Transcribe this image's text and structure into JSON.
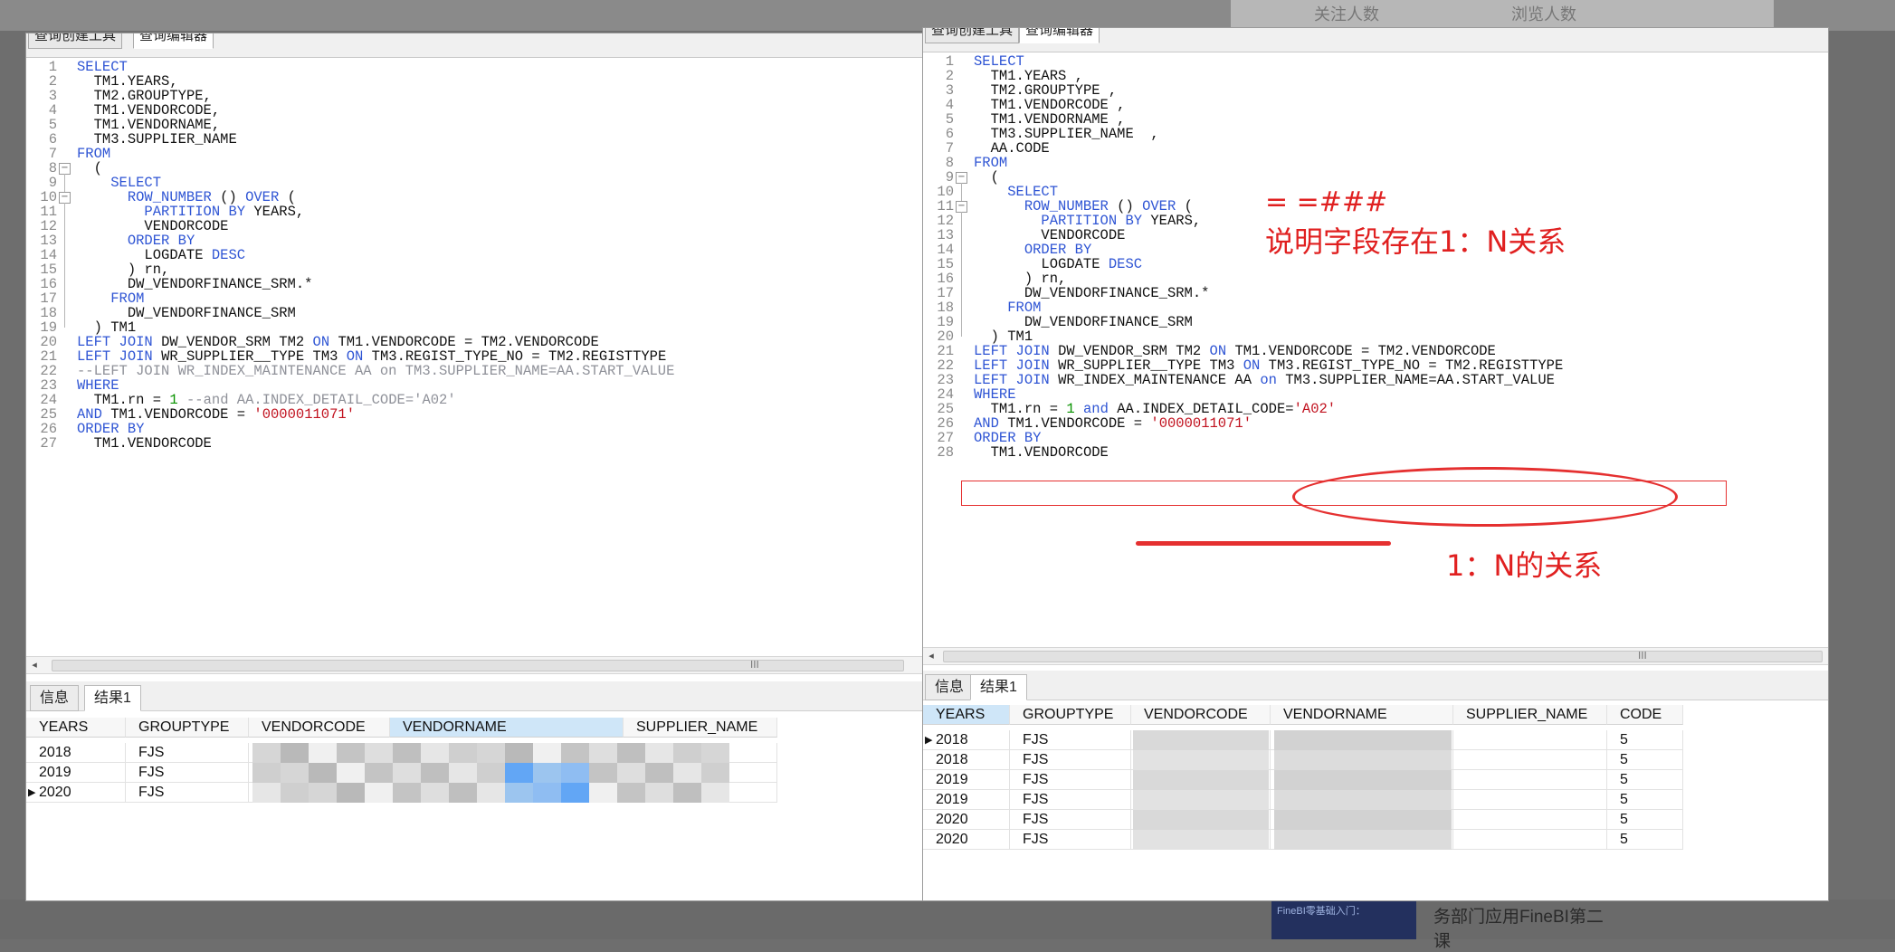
{
  "background": {
    "header_cols": [
      "关注人数",
      "浏览人数"
    ],
    "promo_image_text": "FineBI零基础入门：",
    "promo_text": "务部门应用FineBI第二",
    "promo_text_2": "课"
  },
  "left": {
    "tabs": [
      "查询创建工具",
      "查询编辑器"
    ],
    "code": [
      "SELECT",
      "  TM1.YEARS,",
      "  TM2.GROUPTYPE,",
      "  TM1.VENDORCODE,",
      "  TM1.VENDORNAME,",
      "  TM3.SUPPLIER_NAME",
      "FROM",
      "  (",
      "    SELECT",
      "      ROW_NUMBER () OVER (",
      "        PARTITION BY YEARS,",
      "        VENDORCODE",
      "      ORDER BY",
      "        LOGDATE DESC",
      "      ) rn,",
      "      DW_VENDORFINANCE_SRM.*",
      "    FROM",
      "      DW_VENDORFINANCE_SRM",
      "  ) TM1",
      "LEFT JOIN DW_VENDOR_SRM TM2 ON TM1.VENDORCODE = TM2.VENDORCODE",
      "LEFT JOIN WR_SUPPLIER__TYPE TM3 ON TM3.REGIST_TYPE_NO = TM2.REGISTTYPE",
      "--LEFT JOIN WR_INDEX_MAINTENANCE AA on TM3.SUPPLIER_NAME=AA.START_VALUE",
      "WHERE",
      "  TM1.rn = 1 --and AA.INDEX_DETAIL_CODE='A02'",
      "AND TM1.VENDORCODE = '0000011071'",
      "ORDER BY",
      "  TM1.VENDORCODE"
    ],
    "result_tabs": [
      "信息",
      "结果1"
    ],
    "columns": [
      "YEARS",
      "GROUPTYPE",
      "VENDORCODE",
      "VENDORNAME",
      "SUPPLIER_NAME"
    ],
    "rows": [
      [
        "2018",
        "FJS"
      ],
      [
        "2019",
        "FJS"
      ],
      [
        "2020",
        "FJS"
      ]
    ],
    "scroll_grip": "III"
  },
  "right": {
    "tabs": [
      "查询创建工具",
      "查询编辑器"
    ],
    "code": [
      "SELECT",
      "  TM1.YEARS ,",
      "  TM2.GROUPTYPE ,",
      "  TM1.VENDORCODE ,",
      "  TM1.VENDORNAME ,",
      "  TM3.SUPPLIER_NAME  ,",
      "  AA.CODE",
      "FROM",
      "  (",
      "    SELECT",
      "      ROW_NUMBER () OVER (",
      "        PARTITION BY YEARS,",
      "        VENDORCODE",
      "      ORDER BY",
      "        LOGDATE DESC",
      "      ) rn,",
      "      DW_VENDORFINANCE_SRM.*",
      "    FROM",
      "      DW_VENDORFINANCE_SRM",
      "  ) TM1",
      "LEFT JOIN DW_VENDOR_SRM TM2 ON TM1.VENDORCODE = TM2.VENDORCODE",
      "LEFT JOIN WR_SUPPLIER__TYPE TM3 ON TM3.REGIST_TYPE_NO = TM2.REGISTTYPE",
      "LEFT JOIN WR_INDEX_MAINTENANCE AA on TM3.SUPPLIER_NAME=AA.START_VALUE",
      "WHERE",
      "  TM1.rn = 1 and AA.INDEX_DETAIL_CODE='A02'",
      "AND TM1.VENDORCODE = '0000011071'",
      "ORDER BY",
      "  TM1.VENDORCODE"
    ],
    "result_tabs": [
      "信息",
      "结果1"
    ],
    "columns": [
      "YEARS",
      "GROUPTYPE",
      "VENDORCODE",
      "VENDORNAME",
      "SUPPLIER_NAME",
      "CODE"
    ],
    "rows": [
      [
        "2018",
        "FJS",
        "5"
      ],
      [
        "2018",
        "FJS",
        "5"
      ],
      [
        "2019",
        "FJS",
        "5"
      ],
      [
        "2019",
        "FJS",
        "5"
      ],
      [
        "2020",
        "FJS",
        "5"
      ],
      [
        "2020",
        "FJS",
        "5"
      ]
    ],
    "scroll_grip": "III"
  },
  "annotations": {
    "hash_note": "= =###",
    "relation_note": "说明字段存在1：N关系",
    "bottom_note": "1：N的关系"
  },
  "colors": {
    "keyword": "#2f55d4",
    "number": "#099200",
    "string": "#c1121f",
    "comment": "#8f9199",
    "annotation": "#e53030"
  }
}
